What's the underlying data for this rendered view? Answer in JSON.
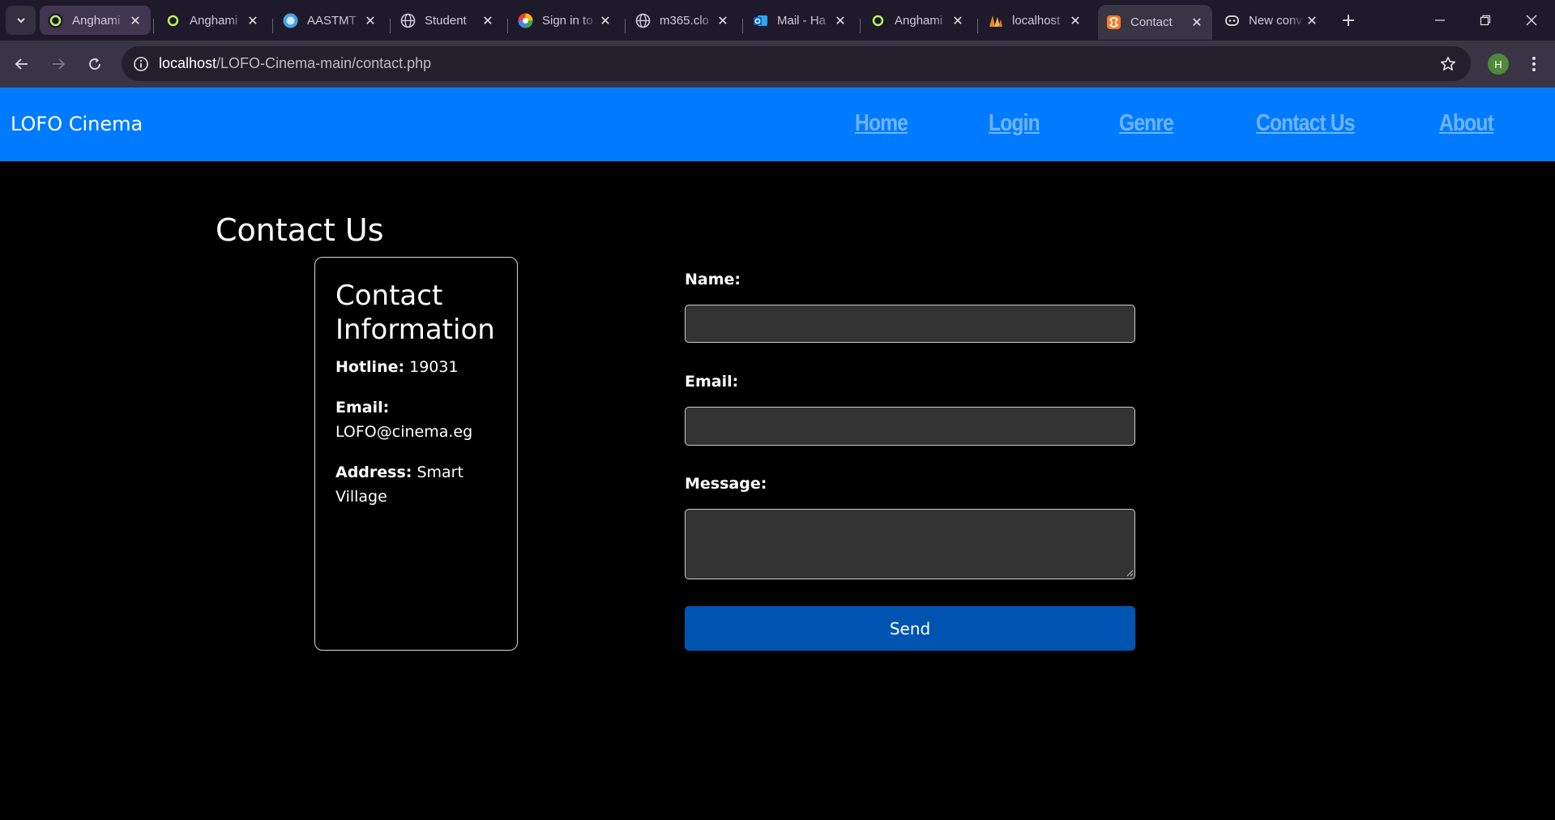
{
  "browser": {
    "tabs": [
      {
        "title": "Anghami",
        "favicon": "anghami-icon"
      },
      {
        "title": "Anghami",
        "favicon": "anghami-icon"
      },
      {
        "title": "AASTMT",
        "favicon": "aastmt-icon"
      },
      {
        "title": "Student",
        "favicon": "globe-icon"
      },
      {
        "title": "Sign in to",
        "favicon": "microsoft-icon"
      },
      {
        "title": "m365.clo",
        "favicon": "globe-icon"
      },
      {
        "title": "Mail - Ha",
        "favicon": "outlook-icon"
      },
      {
        "title": "Anghami",
        "favicon": "anghami-icon"
      },
      {
        "title": "localhost",
        "favicon": "xampp-icon"
      },
      {
        "title": "Contact",
        "favicon": "xampp-icon"
      },
      {
        "title": "New conv",
        "favicon": "copilot-icon"
      }
    ],
    "url_host": "localhost",
    "url_path": "/LOFO-Cinema-main/contact.php",
    "profile_initial": "H"
  },
  "site": {
    "brand": "LOFO Cinema",
    "nav": [
      "Home",
      "Login",
      "Genre",
      "Contact Us",
      "About"
    ],
    "nav_color": "#6fb4f5",
    "header_color": "#007bff"
  },
  "page": {
    "title": "Contact Us",
    "info": {
      "heading": "Contact Information",
      "hotline_label": "Hotline:",
      "hotline_value": "19031",
      "email_label": "Email:",
      "email_value": "LOFO@cinema.eg",
      "address_label": "Address:",
      "address_value": "Smart Village"
    },
    "form": {
      "name_label": "Name:",
      "name_value": "",
      "email_label": "Email:",
      "email_value": "",
      "message_label": "Message:",
      "message_value": "",
      "send_label": "Send"
    }
  }
}
